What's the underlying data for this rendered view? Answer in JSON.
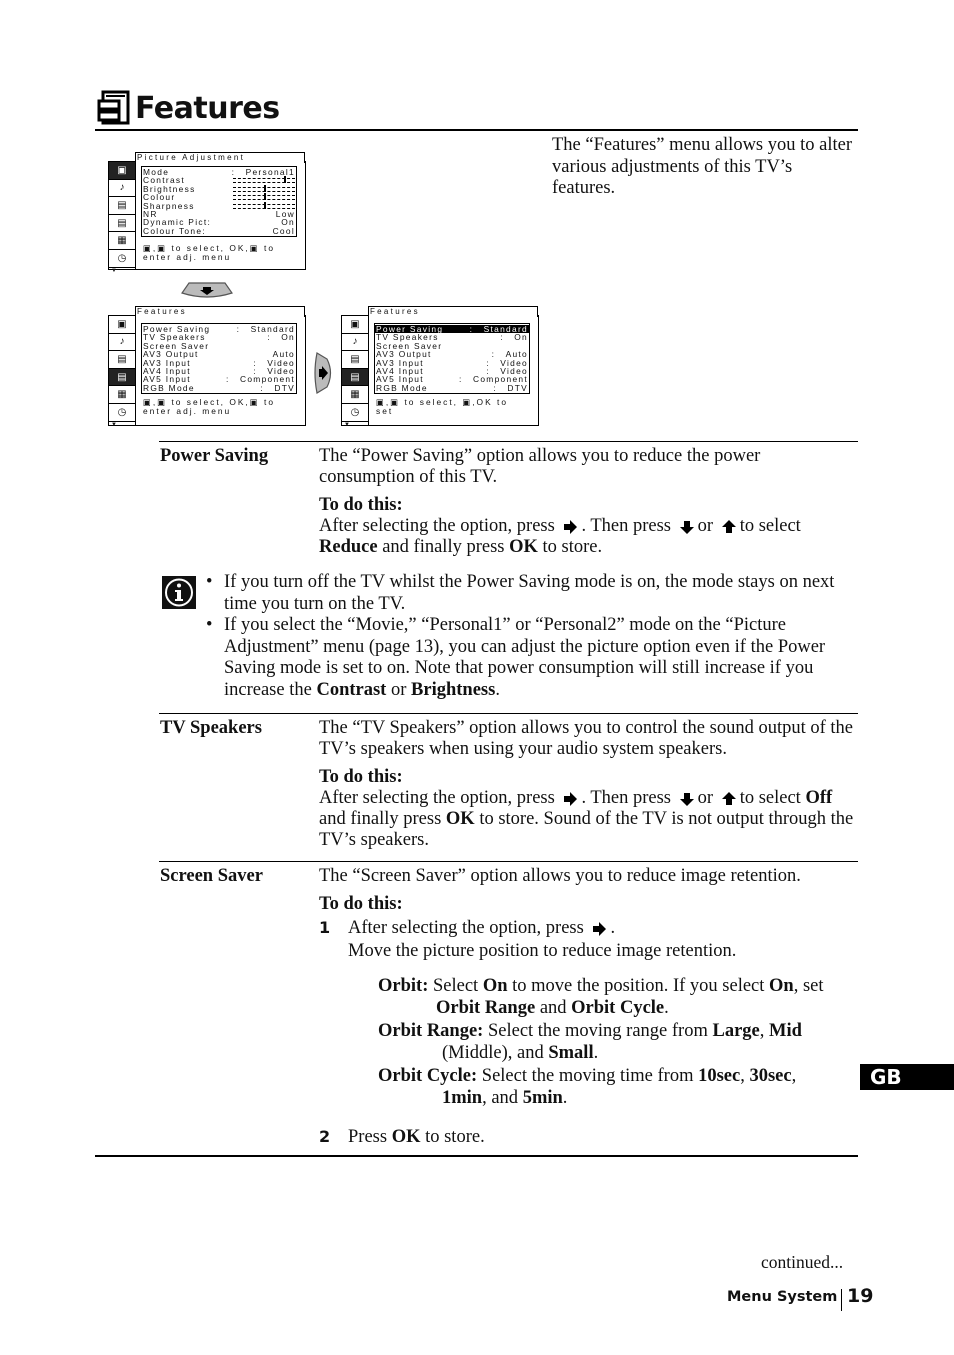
{
  "header": {
    "icon": "features-cabinet-icon",
    "title": "Features",
    "intro": "The “Features” menu allows you to alter various adjustments of this TV’s features."
  },
  "screens": {
    "picture_adjustment": {
      "title": "Picture Adjustment",
      "sidebar_icons": [
        "picture-icon",
        "sound-icon",
        "screen-icon",
        "features-icon",
        "setup-icon",
        "timer-icon"
      ],
      "active_icon_index": 0,
      "rows": [
        {
          "label": "Mode",
          "colon": ":",
          "value": "Personal1"
        },
        {
          "label": "Contrast",
          "colon": "",
          "value": "",
          "level": 0.83
        },
        {
          "label": "Brightness",
          "colon": "",
          "value": "",
          "level": 0.5
        },
        {
          "label": "Colour",
          "colon": "",
          "value": "",
          "level": 0.5
        },
        {
          "label": "Sharpness",
          "colon": "",
          "value": "",
          "level": 0.5
        },
        {
          "label": "NR",
          "colon": "",
          "value": "Low"
        },
        {
          "label": "Dynamic Pict:",
          "colon": "",
          "value": "On"
        },
        {
          "label": "Colour Tone:",
          "colon": "",
          "value": "Cool"
        }
      ],
      "footer_line1": "▣,▣ to select, OK,▣ to",
      "footer_line2": "enter adj. menu"
    },
    "features_a": {
      "title": "Features",
      "active_icon_index": 3,
      "rows": [
        {
          "label": "Power Saving",
          "colon": ":",
          "value": "Standard"
        },
        {
          "label": "TV Speakers",
          "colon": ":",
          "value": "On"
        },
        {
          "label": "Screen Saver",
          "colon": "",
          "value": ""
        },
        {
          "label": "AV3 Output",
          "colon": "",
          "value": "Auto"
        },
        {
          "label": "AV3 Input",
          "colon": ":",
          "value": "Video"
        },
        {
          "label": "AV4 Input",
          "colon": ":",
          "value": "Video"
        },
        {
          "label": "AV5 Input",
          "colon": ":",
          "value": "Component"
        },
        {
          "label": "RGB Mode",
          "colon": ":",
          "value": "DTV"
        }
      ],
      "footer_line1": "▣,▣ to select, OK,▣ to",
      "footer_line2": "enter adj. menu"
    },
    "features_b": {
      "title": "Features",
      "active_icon_index": 3,
      "selected_row": 0,
      "rows": [
        {
          "label": "Power Saving",
          "colon": ":",
          "value": "Standard"
        },
        {
          "label": "TV Speakers",
          "colon": ":",
          "value": "On"
        },
        {
          "label": "Screen Saver",
          "colon": "",
          "value": ""
        },
        {
          "label": "AV3 Output",
          "colon": ":",
          "value": "Auto"
        },
        {
          "label": "AV3 Input",
          "colon": ":",
          "value": "Video"
        },
        {
          "label": "AV4 Input",
          "colon": ":",
          "value": "Video"
        },
        {
          "label": "AV5 Input",
          "colon": ":",
          "value": "Component"
        },
        {
          "label": "RGB Mode",
          "colon": ":",
          "value": "DTV"
        }
      ],
      "footer_line1": "▣,▣ to select, ▣,OK to",
      "footer_line2": "set"
    },
    "nav_down_icon": "remote-down-button-icon",
    "nav_right_icon": "remote-right-button-icon"
  },
  "sections": {
    "power_saving": {
      "term": "Power Saving",
      "desc": "The “Power Saving” option allows you to reduce the power consumption of this TV.",
      "todo": "To do this:",
      "step_a": "After selecting the option, press",
      "step_b": ". Then press",
      "step_c": "or",
      "step_d": "to select",
      "step_bold1": "Reduce",
      "step_e": "and finally press",
      "step_bold2": "OK",
      "step_f": "to store."
    },
    "note": {
      "icon": "info-icon",
      "bullet1": "If you turn off the TV whilst the Power Saving mode is on, the mode stays on next time you turn on the TV.",
      "bullet2_a": "If you select the “Movie,” “Personal1” or “Personal2” mode on the “Picture Adjustment” menu (page 13), you can adjust the picture option even if the Power Saving mode is set to on. Note that power consumption will still increase if you increase the",
      "bullet2_b": "Contrast",
      "bullet2_c": "or",
      "bullet2_d": "Brightness",
      "bullet2_e": "."
    },
    "tv_speakers": {
      "term": "TV Speakers",
      "desc": "The “TV Speakers” option allows you to control the sound output of the TV’s speakers when using your audio system speakers.",
      "todo": "To do this:",
      "step_a": "After selecting the option, press",
      "step_b": ". Then press",
      "step_c": "or",
      "step_d": "to select",
      "step_bold1": "Off",
      "step_e": "and finally press",
      "step_bold2": "OK",
      "step_f": "to store. Sound of the TV is not output through the TV’s speakers."
    },
    "screen_saver": {
      "term": "Screen Saver",
      "desc": "The “Screen Saver” option allows you to reduce image retention.",
      "todo": "To do this:",
      "step1_num": "1",
      "step1_a": "After selecting the option, press",
      "step1_b": ".",
      "step1_line2": "Move the picture position to reduce image retention.",
      "orbit": {
        "label": "Orbit:",
        "t1": "Select",
        "b1": "On",
        "t2": "to move the position. If you select",
        "b2": "On",
        "t3": ", set",
        "b3": "Orbit Range",
        "t4": "and",
        "b4": "Orbit Cycle",
        "t5": "."
      },
      "orbit_range": {
        "label": "Orbit Range:",
        "t1": "Select the moving range from",
        "b1": "Large",
        "t2": ",",
        "b2": "Mid",
        "t3": "(Middle), and",
        "b3": "Small",
        "t4": "."
      },
      "orbit_cycle": {
        "label": "Orbit Cycle:",
        "t1": "Select the moving time from",
        "b1": "10sec",
        "t2": ",",
        "b2": "30sec",
        "t3": ",",
        "b3": "1min",
        "t4": ", and",
        "b4": "5min",
        "t5": "."
      },
      "step2_num": "2",
      "step2_a": "Press",
      "step2_bold": "OK",
      "step2_b": "to store."
    }
  },
  "side_tab": "GB",
  "footer": {
    "continued": "continued...",
    "section": "Menu System",
    "page": "19"
  }
}
